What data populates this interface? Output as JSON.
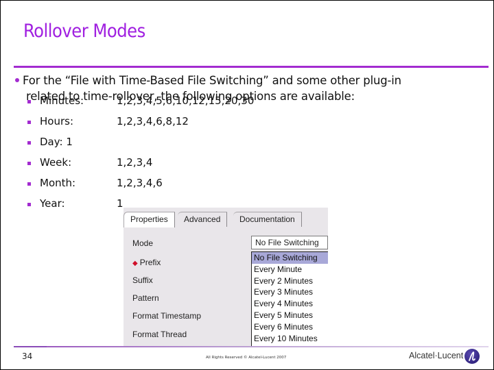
{
  "slide": {
    "title": "Rollover Modes",
    "intro_line1": "For the “File with Time-Based File Switching” and some other plug-in",
    "intro_line2": "related to time-rollover, the following options are available:",
    "options": [
      {
        "label": "Minutes:",
        "values": "1,2,3,4,5,6,10,12,15,20,30"
      },
      {
        "label": "Hours:",
        "values": "1,2,3,4,6,8,12"
      },
      {
        "label": "Day: 1",
        "values": ""
      },
      {
        "label": "Week:",
        "values": "1,2,3,4"
      },
      {
        "label": "Month:",
        "values": "1,2,3,4,6"
      },
      {
        "label": "Year:",
        "values": "1"
      }
    ],
    "accent_color": "#a020e0"
  },
  "panel": {
    "tabs": [
      "Properties",
      "Advanced",
      "Documentation"
    ],
    "active_tab": "Properties",
    "fields": [
      "Mode",
      "Prefix",
      "Suffix",
      "Pattern",
      "Format Timestamp",
      "Format Thread"
    ],
    "required_field": "Prefix",
    "mode_value": "No File Switching",
    "dropdown_options": [
      "No File Switching",
      "Every Minute",
      "Every 2 Minutes",
      "Every 3 Minutes",
      "Every 4 Minutes",
      "Every 5 Minutes",
      "Every 6 Minutes",
      "Every 10 Minutes"
    ],
    "selected_option": "No File Switching"
  },
  "footer": {
    "page_number": "34",
    "copyright": "All Rights Reserved © Alcatel-Lucent 2007",
    "brand": "Alcatel·Lucent"
  }
}
